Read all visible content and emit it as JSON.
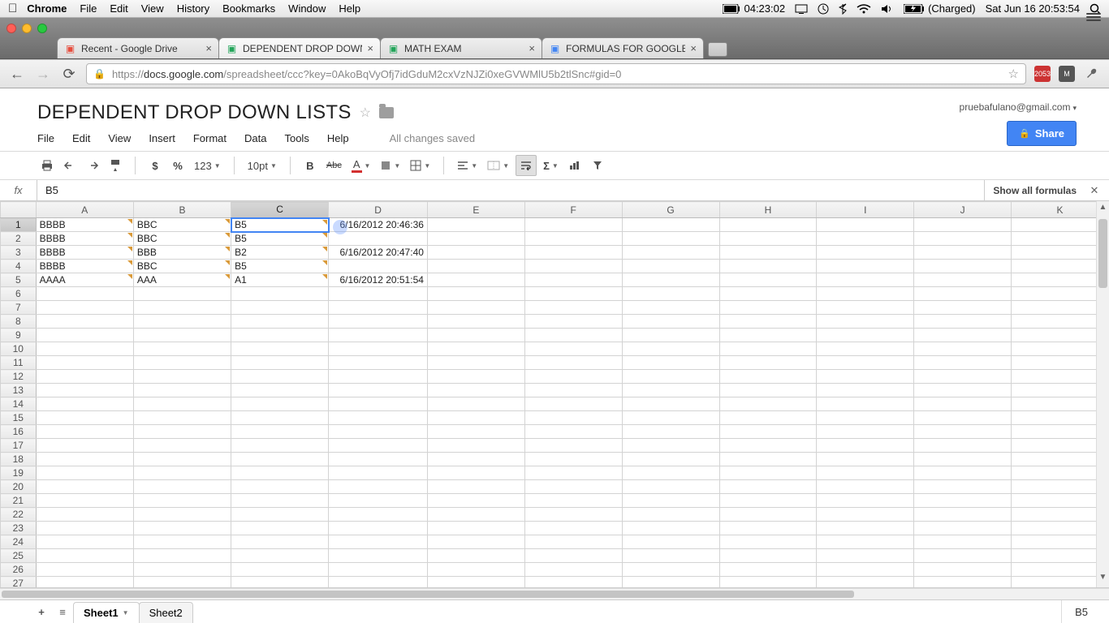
{
  "mac_menu": {
    "app": "Chrome",
    "items": [
      "File",
      "Edit",
      "View",
      "History",
      "Bookmarks",
      "Window",
      "Help"
    ],
    "battery_time": "04:23:02",
    "charge_label": "(Charged)",
    "clock": "Sat Jun 16  20:53:54"
  },
  "browser": {
    "tabs": [
      {
        "title": "Recent - Google Drive",
        "icon_color": "#e74c3c",
        "active": false
      },
      {
        "title": "DEPENDENT DROP DOWN LIS",
        "icon_color": "#23a55a",
        "active": true
      },
      {
        "title": "MATH EXAM",
        "icon_color": "#23a55a",
        "active": false
      },
      {
        "title": "FORMULAS FOR GOOGLE SPR",
        "icon_color": "#4285f4",
        "active": false
      }
    ],
    "url_prefix": "https://",
    "url_host": "docs.google.com",
    "url_path": "/spreadsheet/ccc?key=0AkoBqVyOfj7idGduM2cxVzNJZi0xeGVWMlU5b2tlSnc#gid=0"
  },
  "doc": {
    "title": "DEPENDENT DROP DOWN LISTS",
    "user_email": "pruebafulano@gmail.com",
    "share_label": "Share",
    "menus": [
      "File",
      "Edit",
      "View",
      "Insert",
      "Format",
      "Data",
      "Tools",
      "Help"
    ],
    "saved_msg": "All changes saved",
    "font_size": "10pt",
    "num_format": "123",
    "show_formulas_label": "Show all formulas",
    "fx_label": "fx"
  },
  "formula_bar": {
    "value": "B5"
  },
  "columns": [
    "A",
    "B",
    "C",
    "D",
    "E",
    "F",
    "G",
    "H",
    "I",
    "J",
    "K"
  ],
  "selected_col": "C",
  "selected_row": 1,
  "total_rows": 27,
  "cells": {
    "1": {
      "A": "BBBB",
      "B": "BBC",
      "C": "B5",
      "D": "6/16/2012 20:46:36"
    },
    "2": {
      "A": "BBBB",
      "B": "BBC",
      "C": "B5"
    },
    "3": {
      "A": "BBBB",
      "B": "BBB",
      "C": "B2",
      "D": "6/16/2012 20:47:40"
    },
    "4": {
      "A": "BBBB",
      "B": "BBC",
      "C": "B5"
    },
    "5": {
      "A": "AAAA",
      "B": "AAA",
      "C": "A1",
      "D": "6/16/2012 20:51:54"
    }
  },
  "dv_columns": [
    "A",
    "B",
    "C"
  ],
  "dv_rows": 5,
  "sheet_tabs": [
    {
      "name": "Sheet1",
      "active": true
    },
    {
      "name": "Sheet2",
      "active": false
    }
  ],
  "footer_cellref": "B5",
  "traffic": {
    "close": "#ff5f57",
    "min": "#ffbd2e",
    "max": "#28c940"
  }
}
